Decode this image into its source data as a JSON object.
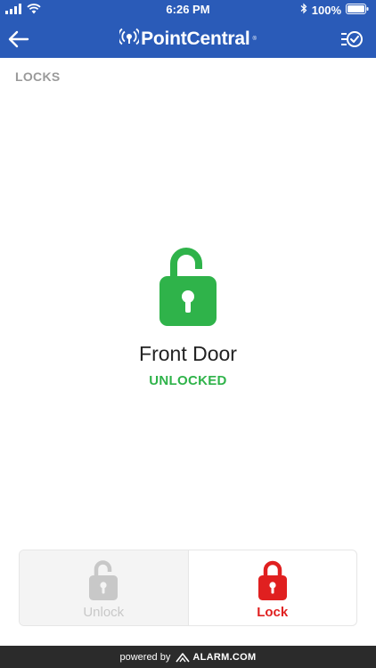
{
  "status_bar": {
    "time": "6:26 PM",
    "battery": "100%"
  },
  "header": {
    "brand": "PointCentral",
    "brand_mark": "®",
    "back_icon": "arrow-left-icon",
    "menu_icon": "checklist-icon"
  },
  "section": {
    "title": "LOCKS"
  },
  "lock": {
    "name": "Front Door",
    "status": "UNLOCKED",
    "status_color": "#2fb34a",
    "icon": "padlock-open-icon"
  },
  "actions": {
    "unlock_label": "Unlock",
    "lock_label": "Lock",
    "lock_color": "#e02020",
    "disabled_color": "#c8c8c8"
  },
  "footer": {
    "powered_by": "powered by",
    "provider": "ALARM.COM"
  },
  "colors": {
    "header_bg": "#2a5bb8",
    "footer_bg": "#2b2b2b"
  }
}
